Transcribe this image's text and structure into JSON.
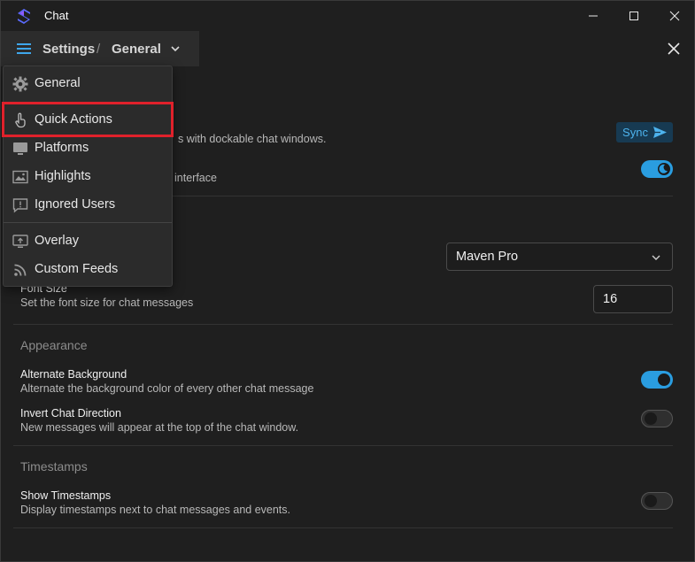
{
  "window": {
    "title": "Chat"
  },
  "header": {
    "breadcrumb_root": "Settings",
    "breadcrumb_sep": "/",
    "breadcrumb_current": "General"
  },
  "menu": {
    "items": [
      {
        "label": "General",
        "icon": "gear-icon"
      },
      {
        "label": "Quick Actions",
        "icon": "hand-pointer-icon"
      },
      {
        "label": "Platforms",
        "icon": "monitor-icon"
      },
      {
        "label": "Highlights",
        "icon": "image-icon"
      },
      {
        "label": "Ignored Users",
        "icon": "chat-alert-icon"
      },
      {
        "label": "Overlay",
        "icon": "screen-upload-icon"
      },
      {
        "label": "Custom Feeds",
        "icon": "rss-icon"
      }
    ],
    "highlighted_item": "Quick Actions"
  },
  "general": {
    "row1_desc_partial": "s with dockable chat windows.",
    "sync_label": "Sync",
    "row2_desc_partial": "interface",
    "dark_mode_on": true
  },
  "font": {
    "family_value": "Maven Pro",
    "size_title": "Font Size",
    "size_desc": "Set the font size for chat messages",
    "size_value": "16"
  },
  "appearance": {
    "section_title": "Appearance",
    "alt_bg_title": "Alternate Background",
    "alt_bg_desc": "Alternate the background color of every other chat message",
    "alt_bg_on": true,
    "invert_title": "Invert Chat Direction",
    "invert_desc": "New messages will appear at the top of the chat window.",
    "invert_on": false
  },
  "timestamps": {
    "section_title": "Timestamps",
    "show_title": "Show Timestamps",
    "show_desc": "Display timestamps next to chat messages and events.",
    "show_on": false
  },
  "colors": {
    "accent": "#2a9de0",
    "highlight_border": "#e0212b",
    "background": "#1f1f1f"
  }
}
